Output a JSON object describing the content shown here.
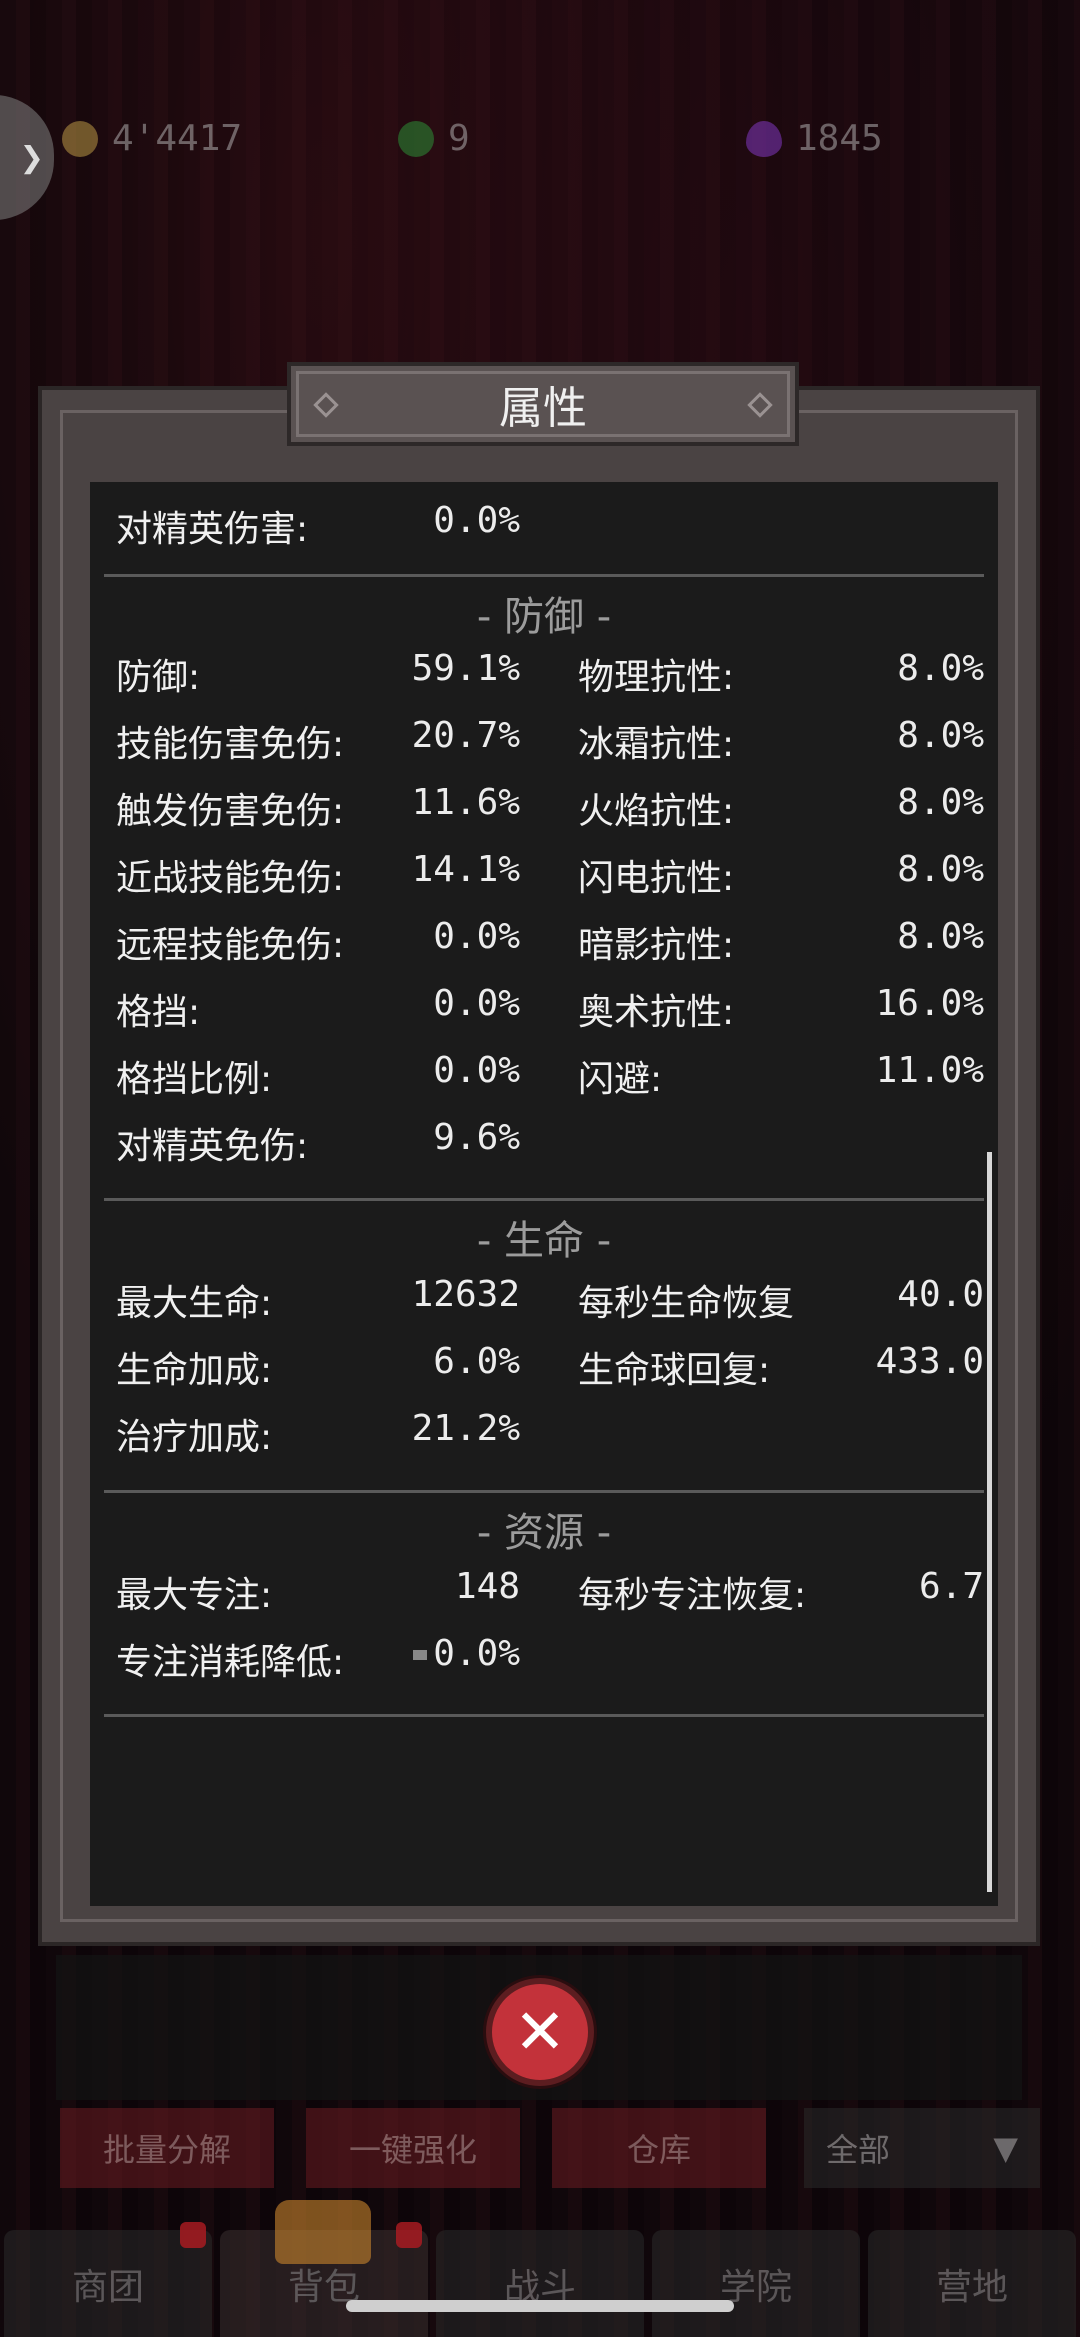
{
  "currencies": [
    {
      "icon": "gold-coin-icon",
      "color": "#c9a54a",
      "value": "4'4417"
    },
    {
      "icon": "green-gem-icon",
      "color": "#2e9a3a",
      "value": "9"
    },
    {
      "icon": "purple-drop-icon",
      "color": "#8a3bd0",
      "value": "1845"
    }
  ],
  "panel": {
    "title": "属性",
    "rows_top": [
      {
        "label": "对精英伤害:",
        "value": "0.0%"
      }
    ],
    "sections": {
      "defense": {
        "header": "- 防御 -",
        "rows": [
          {
            "l1": "防御:",
            "v1": "59.1%",
            "l2": "物理抗性:",
            "v2": "8.0%"
          },
          {
            "l1": "技能伤害免伤:",
            "v1": "20.7%",
            "l2": "冰霜抗性:",
            "v2": "8.0%"
          },
          {
            "l1": "触发伤害免伤:",
            "v1": "11.6%",
            "l2": "火焰抗性:",
            "v2": "8.0%"
          },
          {
            "l1": "近战技能免伤:",
            "v1": "14.1%",
            "l2": "闪电抗性:",
            "v2": "8.0%"
          },
          {
            "l1": "远程技能免伤:",
            "v1": "0.0%",
            "l2": "暗影抗性:",
            "v2": "8.0%"
          },
          {
            "l1": "格挡:",
            "v1": "0.0%",
            "l2": "奥术抗性:",
            "v2": "16.0%"
          },
          {
            "l1": "格挡比例:",
            "v1": "0.0%",
            "l2": "闪避:",
            "v2": "11.0%"
          },
          {
            "l1": "对精英免伤:",
            "v1": "9.6%",
            "l2": "",
            "v2": ""
          }
        ]
      },
      "life": {
        "header": "- 生命 -",
        "rows": [
          {
            "l1": "最大生命:",
            "v1": "12632",
            "l2": "每秒生命恢复",
            "v2": "40.0"
          },
          {
            "l1": "生命加成:",
            "v1": "6.0%",
            "l2": "生命球回复:",
            "v2": "433.0"
          },
          {
            "l1": "治疗加成:",
            "v1": "21.2%",
            "l2": "",
            "v2": ""
          }
        ]
      },
      "resource": {
        "header": "- 资源 -",
        "rows": [
          {
            "l1": "最大专注:",
            "v1": "148",
            "l2": "每秒专注恢复:",
            "v2": "6.7"
          },
          {
            "l1": "专注消耗降低:",
            "v1": "0.0%",
            "l2": "",
            "v2": ""
          }
        ]
      }
    }
  },
  "actions": {
    "batch_decompose": "批量分解",
    "one_click_enhance": "一键强化",
    "warehouse": "仓库",
    "filter_value": "全部"
  },
  "nav": [
    "商团",
    "背包",
    "战斗",
    "学院",
    "营地"
  ],
  "colors": {
    "accent_red": "#c3323a",
    "panel_bg": "#4a4343",
    "content_bg": "#1b1b1b"
  }
}
